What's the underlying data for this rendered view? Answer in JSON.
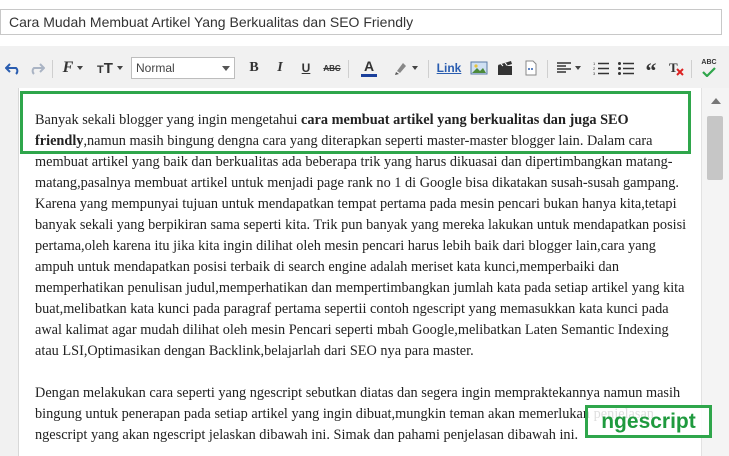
{
  "post": {
    "title": "Cara Mudah Membuat Artikel Yang Berkualitas dan SEO Friendly"
  },
  "toolbar": {
    "format_value": "Normal",
    "link_label": "Link",
    "bold_label": "B",
    "italic_label": "I",
    "underline_label": "U",
    "strike_label": "ABC",
    "font_label": "F",
    "size_label": "T",
    "text_color_label": "A",
    "spell_label": "ABC",
    "accent": "#2a5db0",
    "text_color_bar": "#1a3f9b"
  },
  "content": {
    "p1_start": "Banyak sekali blogger yang ingin mengetahui ",
    "p1_bold": "cara membuat artikel yang berkualitas dan juga SEO friendly",
    "p1_rest": ",namun masih bingung dengna cara yang diterapkan seperti master-master blogger lain. Dalam cara membuat artikel yang baik dan berkualitas ada beberapa trik yang harus dikuasai dan dipertimbangkan matang-matang,pasalnya membuat artikel untuk menjadi page rank no 1 di Google bisa dikatakan susah-susah gampang. Karena yang mempunyai tujuan untuk mendapatkan tempat pertama pada mesin pencari bukan hanya kita,tetapi banyak sekali yang berpikiran sama seperti kita. Trik pun banyak yang mereka lakukan untuk mendapatkan posisi pertama,oleh karena itu jika kita ingin dilihat oleh mesin pencari harus lebih baik dari blogger lain,cara yang ampuh untuk mendapatkan posisi terbaik di search engine adalah meriset kata kunci,memperbaiki dan memperhatikan penulisan judul,memperhatikan dan mempertimbangkan jumlah kata pada setiap artikel yang kita buat,melibatkan kata kunci pada paragraf pertama sepertii contoh ngescript yang memasukkan kata kunci pada awal kalimat agar mudah dilihat oleh mesin Pencari seperti mbah Google,melibatkan Laten Semantic Indexing atau LSI,Optimasikan dengan Backlink,belajarlah dari SEO nya para master.",
    "p2": "Dengan melakukan cara seperti yang ngescript sebutkan diatas dan segera ingin mempraktekannya namun masih bingung untuk penerapan pada setiap artikel yang ingin dibuat,mungkin teman akan memerlukan penjelasan ngescript yang akan ngescript jelaskan dibawah ini. Simak dan pahami penjelasan dibawah ini."
  },
  "watermark": {
    "text": "ngescript",
    "color": "#2fa64b"
  }
}
